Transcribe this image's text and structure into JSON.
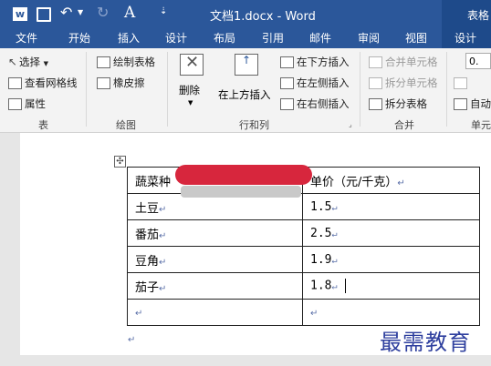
{
  "title": {
    "doc": "文档1.docx - Word",
    "context": "表格"
  },
  "tabs": [
    {
      "label": "文件"
    },
    {
      "label": "开始"
    },
    {
      "label": "插入"
    },
    {
      "label": "设计"
    },
    {
      "label": "布局"
    },
    {
      "label": "引用"
    },
    {
      "label": "邮件"
    },
    {
      "label": "审阅"
    },
    {
      "label": "视图"
    },
    {
      "label": "设计"
    }
  ],
  "ribbon": {
    "table": {
      "select": "选择",
      "gridlines": "查看网格线",
      "properties": "属性",
      "label": "表"
    },
    "draw": {
      "draw_table": "绘制表格",
      "eraser": "橡皮擦",
      "label": "绘图"
    },
    "rowscols": {
      "delete": "删除",
      "insert_above": "在上方插入",
      "insert_below": "在下方插入",
      "insert_left": "在左侧插入",
      "insert_right": "在右侧插入",
      "label": "行和列"
    },
    "merge": {
      "merge_cells": "合并单元格",
      "split_cells": "拆分单元格",
      "split_table": "拆分表格",
      "label": "合并"
    },
    "cellsize": {
      "height_value": "0.",
      "autofit": "自动",
      "label": "单元"
    }
  },
  "document": {
    "rows": [
      [
        "蔬菜种",
        "单价（元/千克）"
      ],
      [
        "土豆",
        "1.5"
      ],
      [
        "番茄",
        "2.5"
      ],
      [
        "豆角",
        "1.9"
      ],
      [
        "茄子",
        "1.8"
      ],
      [
        "",
        ""
      ]
    ],
    "para_mark": "↵"
  },
  "watermark": "最需教育",
  "colors": {
    "accent": "#2b579a",
    "watermark": "#2e3f9e",
    "redaction": "#d7263d"
  }
}
